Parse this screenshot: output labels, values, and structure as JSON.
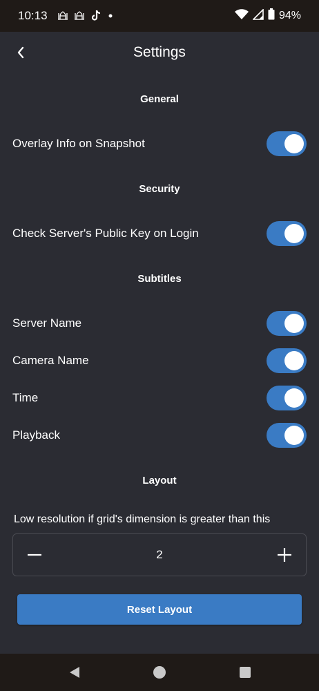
{
  "status_bar": {
    "time": "10:13",
    "battery": "94%",
    "icons": [
      "mosque-icon",
      "mosque-icon",
      "tiktok-icon",
      "dot-icon",
      "wifi-icon",
      "signal-icon",
      "battery-icon"
    ]
  },
  "header": {
    "title": "Settings"
  },
  "sections": {
    "general": {
      "title": "General",
      "items": [
        {
          "label": "Overlay Info on Snapshot",
          "enabled": true
        }
      ]
    },
    "security": {
      "title": "Security",
      "items": [
        {
          "label": "Check Server's Public Key on Login",
          "enabled": true
        }
      ]
    },
    "subtitles": {
      "title": "Subtitles",
      "items": [
        {
          "label": "Server Name",
          "enabled": true
        },
        {
          "label": "Camera Name",
          "enabled": true
        },
        {
          "label": "Time",
          "enabled": true
        },
        {
          "label": "Playback",
          "enabled": true
        }
      ]
    },
    "layout": {
      "title": "Layout",
      "description": "Low resolution if grid's dimension is greater than this",
      "stepper_value": "2",
      "reset_label": "Reset Layout"
    }
  },
  "colors": {
    "background": "#2b2c33",
    "accent": "#3a7bc4",
    "system_bar": "#1f1a17"
  }
}
